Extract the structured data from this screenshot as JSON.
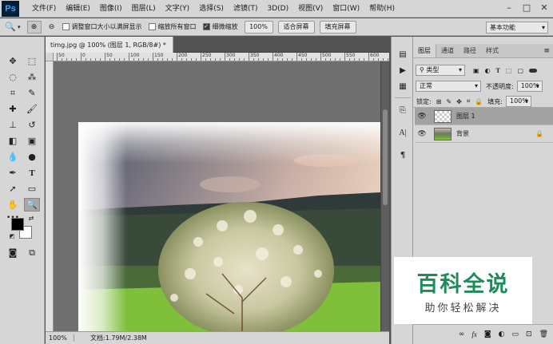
{
  "app": {
    "logo": "Ps"
  },
  "menubar": {
    "items": [
      "文件(F)",
      "编辑(E)",
      "图像(I)",
      "图层(L)",
      "文字(Y)",
      "选择(S)",
      "滤镜(T)",
      "3D(D)",
      "视图(V)",
      "窗口(W)",
      "帮助(H)"
    ],
    "window_controls": [
      "minimize-icon",
      "maximize-icon",
      "close-icon"
    ]
  },
  "options": {
    "resize_windows": "调整窗口大小以满屏显示",
    "zoom_all": "缩放所有窗口",
    "scrubby_zoom": "细微缩放",
    "zoom_value": "100%",
    "fit_screen": "适合屏幕",
    "fill_screen": "填充屏幕",
    "workspace": "基本功能"
  },
  "document": {
    "tab_title": "timg.jpg @ 100% (图层 1, RGB/8#) *",
    "status_zoom": "100%",
    "status_doc": "文档:1.79M/2.38M"
  },
  "rulers": {
    "h_labels": [
      "50",
      "0",
      "50",
      "100",
      "150",
      "200",
      "250",
      "300",
      "350",
      "400",
      "450",
      "500",
      "550",
      "600"
    ]
  },
  "layers_panel": {
    "tabs": [
      "图层",
      "通道",
      "路径",
      "样式"
    ],
    "filter_kind": "类型",
    "blend_mode": "正常",
    "opacity_label": "不透明度:",
    "opacity_value": "100%",
    "lock_label": "锁定:",
    "fill_label": "填充:",
    "fill_value": "100%",
    "layers": [
      {
        "name": "图层 1",
        "visible": true,
        "selected": true,
        "locked": false
      },
      {
        "name": "背景",
        "visible": true,
        "selected": false,
        "locked": true
      }
    ]
  },
  "watermark": {
    "title": "百科全说",
    "subtitle": "助你轻松解决"
  },
  "colors": {
    "foreground": "#000000",
    "background": "#ffffff",
    "watermark_green": "#1e8c5a"
  }
}
